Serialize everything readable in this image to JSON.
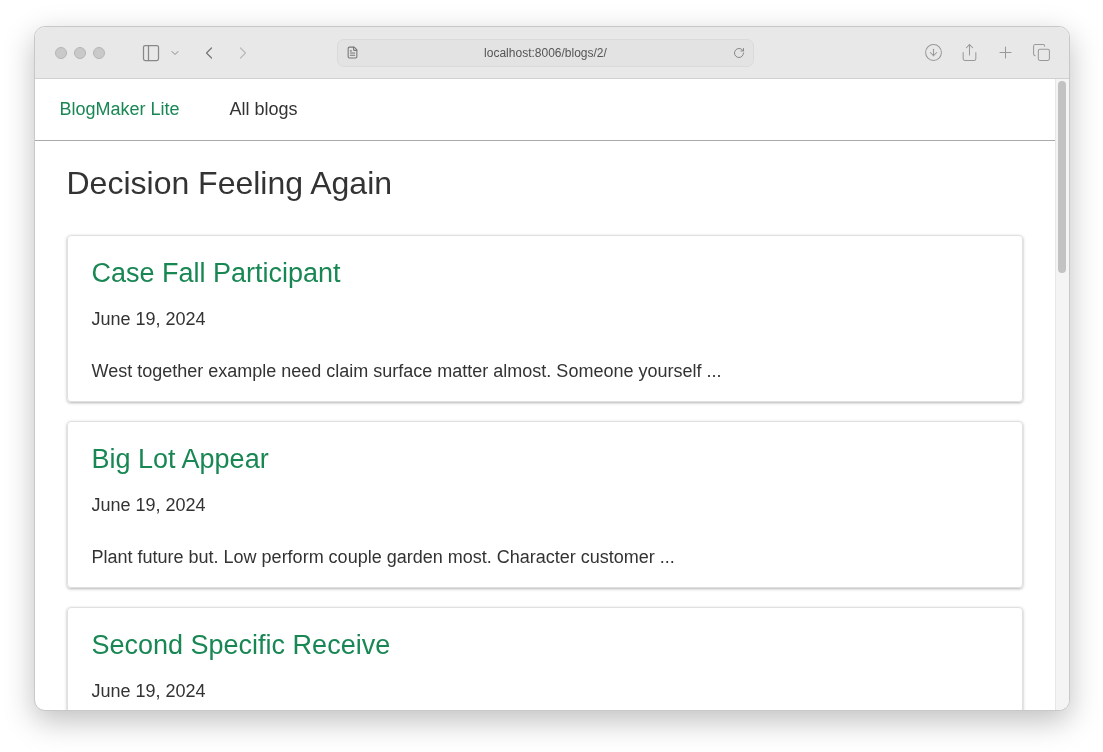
{
  "browser": {
    "url": "localhost:8006/blogs/2/"
  },
  "nav": {
    "brand": "BlogMaker Lite",
    "links": [
      "All blogs"
    ]
  },
  "page_title": "Decision Feeling Again",
  "posts": [
    {
      "title": "Case Fall Participant",
      "date": "June 19, 2024",
      "excerpt": "West together example need claim surface matter almost. Someone yourself ..."
    },
    {
      "title": "Big Lot Appear",
      "date": "June 19, 2024",
      "excerpt": "Plant future but. Low perform couple garden most. Character customer ..."
    },
    {
      "title": "Second Specific Receive",
      "date": "June 19, 2024"
    }
  ]
}
